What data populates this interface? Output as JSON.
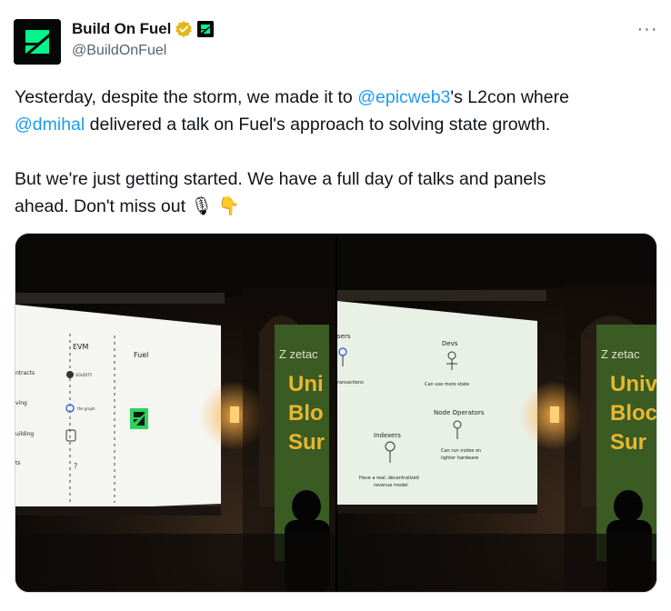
{
  "author": {
    "display_name": "Build On Fuel",
    "handle": "@BuildOnFuel",
    "verified_icon": "verified-badge-gold",
    "affiliate_icon": "fuel-logo"
  },
  "more_label": "···",
  "tweet": {
    "line1_a": "Yesterday, despite the storm, we made it to ",
    "mention1": "@epicweb3",
    "line1_b": "'s L2con where",
    "mention2": "@dmihal",
    "line2_b": " delivered a talk on Fuel's approach to solving state growth.",
    "para2_a": "But we're just getting started. We have a full day of talks and panels",
    "para2_b": "ahead. Don't miss out ",
    "emoji1": "🎙",
    "emoji2": "👇"
  },
  "media": {
    "left_photo": {
      "slide_heads": [
        "EVM",
        "Fuel"
      ],
      "slide_rows": [
        "ntracts",
        "ving",
        "uilding",
        "ts"
      ],
      "slide_cells": [
        "SOLIDITY",
        "the graph",
        "?"
      ]
    },
    "right_photo": {
      "slide_labels": [
        "sers",
        "Devs",
        "ransactions",
        "Can use more state",
        "Node Operators",
        "Indexers",
        "Can run nodes on",
        "lighter hardware",
        "Have a real, decentralized",
        "revenue model"
      ],
      "banner": [
        "zetac",
        "Uni",
        "Blo",
        "Sur"
      ]
    }
  },
  "colors": {
    "link": "#1d9bf0",
    "secondary_text": "#536471",
    "fuel_green": "#00f58c",
    "verified_gold": "#e2b719"
  }
}
